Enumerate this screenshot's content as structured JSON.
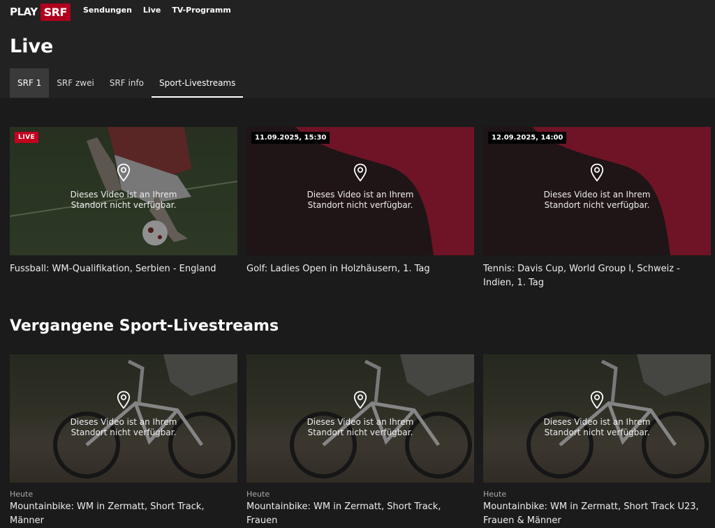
{
  "brand": {
    "play": "PLAY",
    "srf": "SRF"
  },
  "nav": {
    "items": [
      "Sendungen",
      "Live",
      "TV-Programm"
    ]
  },
  "page_title": "Live",
  "tabs": [
    "SRF 1",
    "SRF zwei",
    "SRF info",
    "Sport-Livestreams"
  ],
  "geo_message_line1": "Dieses Video ist an Ihrem",
  "geo_message_line2": "Standort nicht verfügbar.",
  "live_cards": [
    {
      "badge": "LIVE",
      "title": "Fussball: WM-Qualifikation, Serbien - England"
    },
    {
      "badge": "11.09.2025, 15:30",
      "title": "Golf: Ladies Open in Holzhäusern, 1. Tag"
    },
    {
      "badge": "12.09.2025, 14:00",
      "title": "Tennis: Davis Cup, World Group I, Schweiz - Indien, 1. Tag"
    }
  ],
  "past_section_title": "Vergangene Sport-Livestreams",
  "past_cards": [
    {
      "date": "Heute",
      "title": "Mountainbike: WM in Zermatt, Short Track, Männer"
    },
    {
      "date": "Heute",
      "title": "Mountainbike: WM in Zermatt, Short Track, Frauen"
    },
    {
      "date": "Heute",
      "title": "Mountainbike: WM in Zermatt, Short Track U23, Frauen & Männer"
    }
  ],
  "colors": {
    "brand_red": "#af001e",
    "live_red": "#c4001e",
    "wave_red": "#6e1426",
    "background": "#1b1b1b"
  },
  "icons": {
    "geo": "location-pin-icon"
  }
}
